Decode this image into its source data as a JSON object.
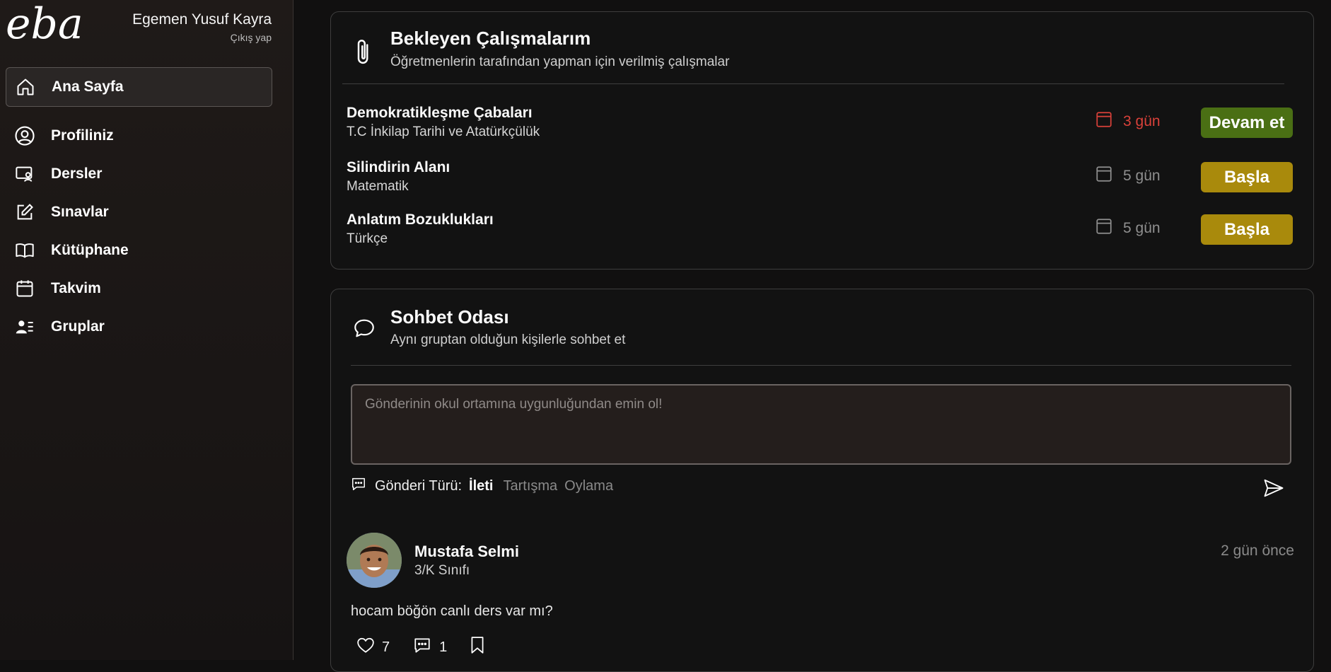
{
  "brand": {
    "logo_text": "eba"
  },
  "user": {
    "name": "Egemen Yusuf Kayra",
    "logout_label": "Çıkış yap"
  },
  "sidebar": {
    "items": [
      {
        "label": "Ana Sayfa",
        "icon": "home-icon",
        "active": true
      },
      {
        "label": "Profiliniz",
        "icon": "user-circle-icon"
      },
      {
        "label": "Dersler",
        "icon": "lessons-icon"
      },
      {
        "label": "Sınavlar",
        "icon": "edit-icon"
      },
      {
        "label": "Kütüphane",
        "icon": "book-icon"
      },
      {
        "label": "Takvim",
        "icon": "calendar-icon"
      },
      {
        "label": "Gruplar",
        "icon": "groups-icon"
      }
    ]
  },
  "pending": {
    "title": "Bekleyen Çalışmalarım",
    "subtitle": "Öğretmenlerin tarafından yapman için verilmiş çalışmalar",
    "icon": "paperclip-icon",
    "tasks": [
      {
        "title": "Demokratikleşme Çabaları",
        "course": "T.C İnkilap Tarihi ve Atatürkçülük",
        "due": "3 gün",
        "urgent": true,
        "action": "Devam et",
        "action_color": "#4a6f14"
      },
      {
        "title": "Silindirin Alanı",
        "course": "Matematik",
        "due": "5 gün",
        "urgent": false,
        "action": "Başla",
        "action_color": "#a98a0c"
      },
      {
        "title": "Anlatım Bozuklukları",
        "course": "Türkçe",
        "due": "5 gün",
        "urgent": false,
        "action": "Başla",
        "action_color": "#a98a0c"
      }
    ]
  },
  "chat": {
    "title": "Sohbet Odası",
    "subtitle": "Aynı gruptan olduğun kişilerle sohbet et",
    "icon": "chat-bubble-icon",
    "input_placeholder": "Gönderinin okul ortamına uygunluğundan emin ol!",
    "post_type_label": "Gönderi Türü:",
    "post_types": [
      "İleti",
      "Tartışma",
      "Oylama"
    ],
    "selected_post_type": "İleti"
  },
  "posts": [
    {
      "author": "Mustafa Selmi",
      "class": "3/K Sınıfı",
      "time": "2 gün önce",
      "text": "hocam böğön canlı ders var mı?",
      "likes": "7",
      "comments": "1"
    }
  ],
  "colors": {
    "urgent": "#d9413a",
    "continue": "#4a6f14",
    "start": "#a98a0c"
  }
}
